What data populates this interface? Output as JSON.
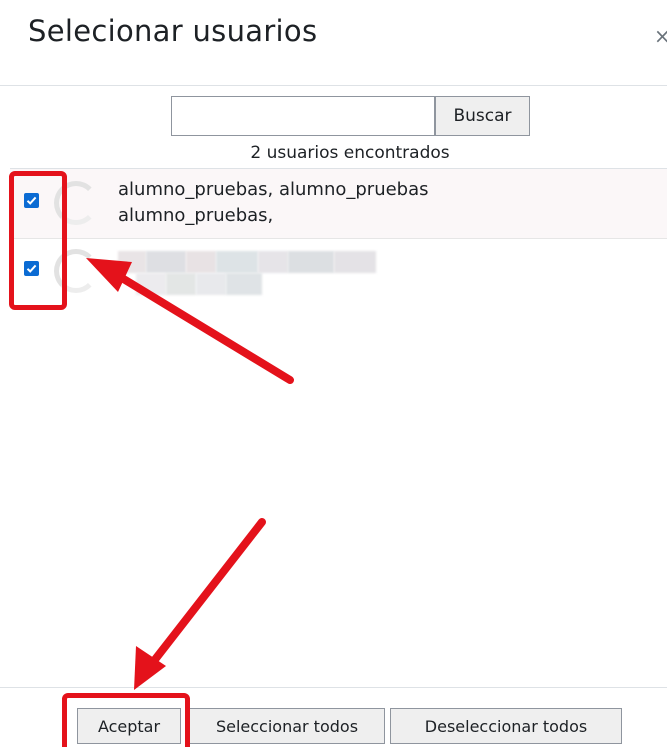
{
  "dialog": {
    "title": "Selecionar usuarios",
    "close_glyph": "×"
  },
  "search": {
    "value": "",
    "placeholder": "",
    "button_label": "Buscar"
  },
  "found_text": "2 usuarios encontrados",
  "users": [
    {
      "checked": true,
      "name": "alumno_pruebas, alumno_pruebas alumno_pruebas,"
    },
    {
      "checked": true,
      "name": ""
    }
  ],
  "footer": {
    "accept_label": "Aceptar",
    "select_all_label": "Seleccionar todos",
    "deselect_all_label": "Deseleccionar todos"
  },
  "annotations": {
    "highlight_color": "#e4121b"
  },
  "colors": {
    "checkbox": "#0b6bd3",
    "button_bg": "#efefef"
  }
}
